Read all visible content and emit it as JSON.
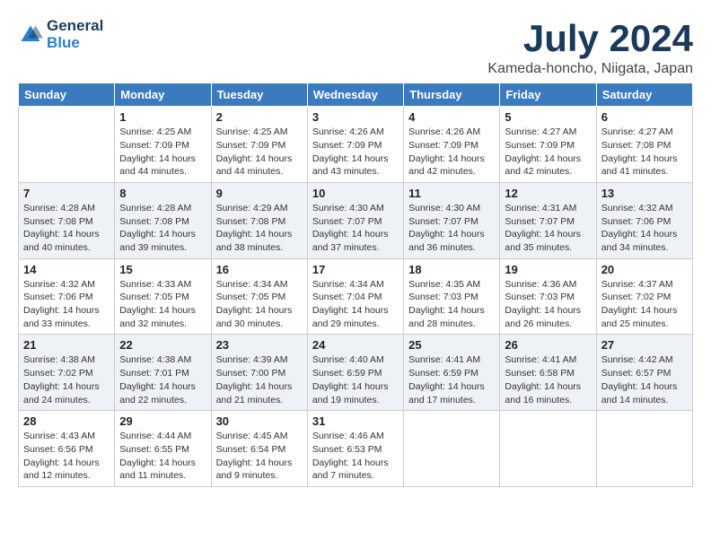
{
  "logo": {
    "line1": "General",
    "line2": "Blue"
  },
  "title": "July 2024",
  "subtitle": "Kameda-honcho, Niigata, Japan",
  "weekdays": [
    "Sunday",
    "Monday",
    "Tuesday",
    "Wednesday",
    "Thursday",
    "Friday",
    "Saturday"
  ],
  "weeks": [
    [
      {
        "day": "",
        "info": ""
      },
      {
        "day": "1",
        "info": "Sunrise: 4:25 AM\nSunset: 7:09 PM\nDaylight: 14 hours\nand 44 minutes."
      },
      {
        "day": "2",
        "info": "Sunrise: 4:25 AM\nSunset: 7:09 PM\nDaylight: 14 hours\nand 44 minutes."
      },
      {
        "day": "3",
        "info": "Sunrise: 4:26 AM\nSunset: 7:09 PM\nDaylight: 14 hours\nand 43 minutes."
      },
      {
        "day": "4",
        "info": "Sunrise: 4:26 AM\nSunset: 7:09 PM\nDaylight: 14 hours\nand 42 minutes."
      },
      {
        "day": "5",
        "info": "Sunrise: 4:27 AM\nSunset: 7:09 PM\nDaylight: 14 hours\nand 42 minutes."
      },
      {
        "day": "6",
        "info": "Sunrise: 4:27 AM\nSunset: 7:08 PM\nDaylight: 14 hours\nand 41 minutes."
      }
    ],
    [
      {
        "day": "7",
        "info": "Sunrise: 4:28 AM\nSunset: 7:08 PM\nDaylight: 14 hours\nand 40 minutes."
      },
      {
        "day": "8",
        "info": "Sunrise: 4:28 AM\nSunset: 7:08 PM\nDaylight: 14 hours\nand 39 minutes."
      },
      {
        "day": "9",
        "info": "Sunrise: 4:29 AM\nSunset: 7:08 PM\nDaylight: 14 hours\nand 38 minutes."
      },
      {
        "day": "10",
        "info": "Sunrise: 4:30 AM\nSunset: 7:07 PM\nDaylight: 14 hours\nand 37 minutes."
      },
      {
        "day": "11",
        "info": "Sunrise: 4:30 AM\nSunset: 7:07 PM\nDaylight: 14 hours\nand 36 minutes."
      },
      {
        "day": "12",
        "info": "Sunrise: 4:31 AM\nSunset: 7:07 PM\nDaylight: 14 hours\nand 35 minutes."
      },
      {
        "day": "13",
        "info": "Sunrise: 4:32 AM\nSunset: 7:06 PM\nDaylight: 14 hours\nand 34 minutes."
      }
    ],
    [
      {
        "day": "14",
        "info": "Sunrise: 4:32 AM\nSunset: 7:06 PM\nDaylight: 14 hours\nand 33 minutes."
      },
      {
        "day": "15",
        "info": "Sunrise: 4:33 AM\nSunset: 7:05 PM\nDaylight: 14 hours\nand 32 minutes."
      },
      {
        "day": "16",
        "info": "Sunrise: 4:34 AM\nSunset: 7:05 PM\nDaylight: 14 hours\nand 30 minutes."
      },
      {
        "day": "17",
        "info": "Sunrise: 4:34 AM\nSunset: 7:04 PM\nDaylight: 14 hours\nand 29 minutes."
      },
      {
        "day": "18",
        "info": "Sunrise: 4:35 AM\nSunset: 7:03 PM\nDaylight: 14 hours\nand 28 minutes."
      },
      {
        "day": "19",
        "info": "Sunrise: 4:36 AM\nSunset: 7:03 PM\nDaylight: 14 hours\nand 26 minutes."
      },
      {
        "day": "20",
        "info": "Sunrise: 4:37 AM\nSunset: 7:02 PM\nDaylight: 14 hours\nand 25 minutes."
      }
    ],
    [
      {
        "day": "21",
        "info": "Sunrise: 4:38 AM\nSunset: 7:02 PM\nDaylight: 14 hours\nand 24 minutes."
      },
      {
        "day": "22",
        "info": "Sunrise: 4:38 AM\nSunset: 7:01 PM\nDaylight: 14 hours\nand 22 minutes."
      },
      {
        "day": "23",
        "info": "Sunrise: 4:39 AM\nSunset: 7:00 PM\nDaylight: 14 hours\nand 21 minutes."
      },
      {
        "day": "24",
        "info": "Sunrise: 4:40 AM\nSunset: 6:59 PM\nDaylight: 14 hours\nand 19 minutes."
      },
      {
        "day": "25",
        "info": "Sunrise: 4:41 AM\nSunset: 6:59 PM\nDaylight: 14 hours\nand 17 minutes."
      },
      {
        "day": "26",
        "info": "Sunrise: 4:41 AM\nSunset: 6:58 PM\nDaylight: 14 hours\nand 16 minutes."
      },
      {
        "day": "27",
        "info": "Sunrise: 4:42 AM\nSunset: 6:57 PM\nDaylight: 14 hours\nand 14 minutes."
      }
    ],
    [
      {
        "day": "28",
        "info": "Sunrise: 4:43 AM\nSunset: 6:56 PM\nDaylight: 14 hours\nand 12 minutes."
      },
      {
        "day": "29",
        "info": "Sunrise: 4:44 AM\nSunset: 6:55 PM\nDaylight: 14 hours\nand 11 minutes."
      },
      {
        "day": "30",
        "info": "Sunrise: 4:45 AM\nSunset: 6:54 PM\nDaylight: 14 hours\nand 9 minutes."
      },
      {
        "day": "31",
        "info": "Sunrise: 4:46 AM\nSunset: 6:53 PM\nDaylight: 14 hours\nand 7 minutes."
      },
      {
        "day": "",
        "info": ""
      },
      {
        "day": "",
        "info": ""
      },
      {
        "day": "",
        "info": ""
      }
    ]
  ]
}
